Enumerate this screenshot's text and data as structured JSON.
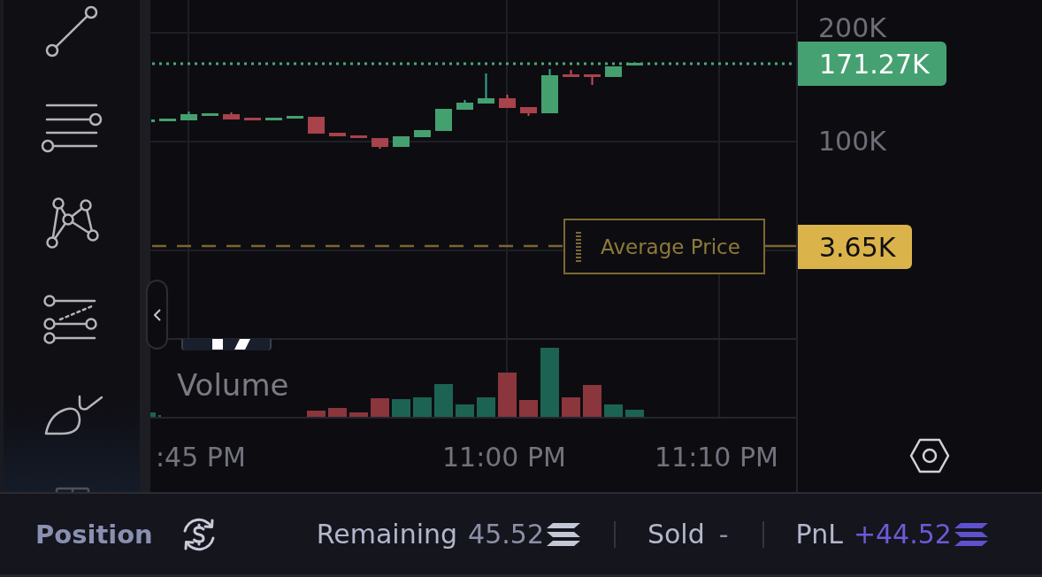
{
  "chart": {
    "price_axis": {
      "labels": [
        "200K",
        "100K"
      ]
    },
    "last_price": "171.27K",
    "average_price": {
      "label": "Average Price",
      "value": "3.65K"
    },
    "volume_pane": {
      "label": "Volume"
    },
    "time_axis": {
      "labels": [
        ":45 PM",
        "11:00 PM",
        "11:10 PM"
      ]
    }
  },
  "position_bar": {
    "title": "Position",
    "remaining": {
      "label": "Remaining",
      "value": "45.52"
    },
    "sold": {
      "label": "Sold",
      "value": "-"
    },
    "pnl": {
      "label": "PnL",
      "value": "+44.52"
    }
  }
}
